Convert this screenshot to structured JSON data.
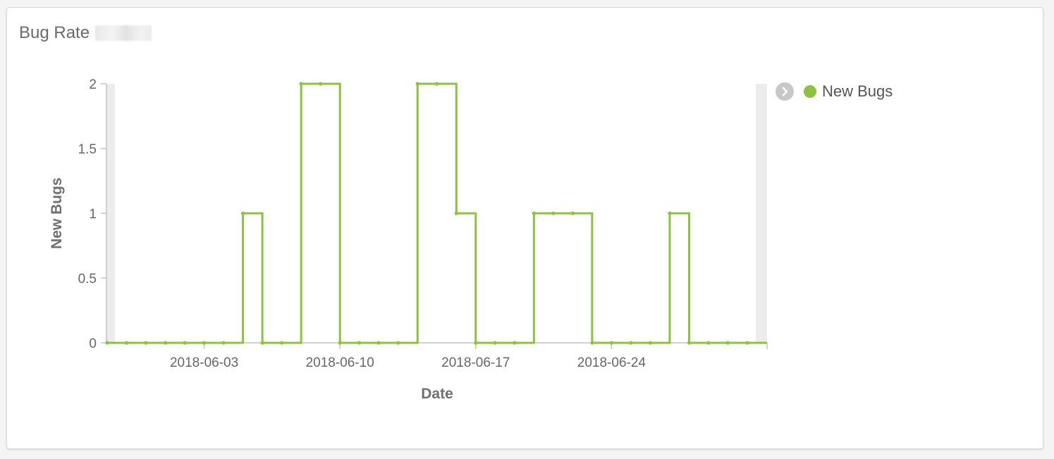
{
  "panel": {
    "title": "Bug Rate"
  },
  "legend": {
    "toggle_icon": "chevron-right-icon",
    "items": [
      {
        "label": "New Bugs",
        "color": "#8cc23f"
      }
    ]
  },
  "chart_data": {
    "type": "line",
    "interpolation": "step",
    "xlabel": "Date",
    "ylabel": "New Bugs",
    "ylim": [
      0,
      2
    ],
    "y_ticks": [
      "0",
      "0.5",
      "1",
      "1.5",
      "2"
    ],
    "x_ticks": [
      "2018-06-03",
      "2018-06-10",
      "2018-06-17",
      "2018-06-24"
    ],
    "x_range": [
      "2018-05-29",
      "2018-07-01"
    ],
    "grid": false,
    "legend_position": "right",
    "series": [
      {
        "name": "New Bugs",
        "color": "#8cc23f",
        "x": [
          "2018-05-29",
          "2018-05-30",
          "2018-05-31",
          "2018-06-01",
          "2018-06-02",
          "2018-06-03",
          "2018-06-04",
          "2018-06-05",
          "2018-06-06",
          "2018-06-07",
          "2018-06-08",
          "2018-06-09",
          "2018-06-10",
          "2018-06-11",
          "2018-06-12",
          "2018-06-13",
          "2018-06-14",
          "2018-06-15",
          "2018-06-16",
          "2018-06-17",
          "2018-06-18",
          "2018-06-19",
          "2018-06-20",
          "2018-06-21",
          "2018-06-22",
          "2018-06-23",
          "2018-06-24",
          "2018-06-25",
          "2018-06-26",
          "2018-06-27",
          "2018-06-28",
          "2018-06-29",
          "2018-06-30",
          "2018-07-01"
        ],
        "values": [
          0,
          0,
          0,
          0,
          0,
          0,
          0,
          1,
          0,
          0,
          2,
          2,
          0,
          0,
          0,
          0,
          2,
          2,
          1,
          0,
          0,
          0,
          1,
          1,
          1,
          0,
          0,
          0,
          0,
          1,
          0,
          0,
          0,
          0
        ]
      }
    ]
  }
}
